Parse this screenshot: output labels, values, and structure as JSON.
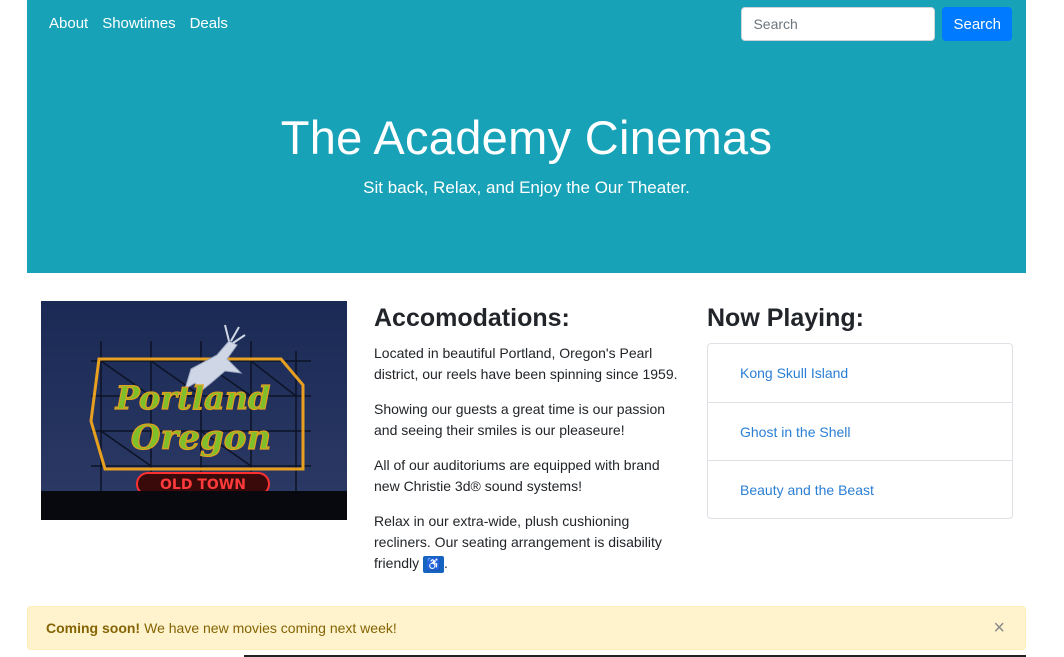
{
  "nav": {
    "links": [
      "About",
      "Showtimes",
      "Deals"
    ]
  },
  "search": {
    "placeholder": "Search",
    "button_label": "Search"
  },
  "hero": {
    "title": "The Academy Cinemas",
    "subtitle": "Sit back, Relax, and Enjoy the Our Theater."
  },
  "image": {
    "sign_text_1": "Portland",
    "sign_text_2": "Oregon",
    "sign_text_3": "OLD TOWN"
  },
  "accommodations": {
    "heading": "Accomodations:",
    "paragraphs": [
      "Located in beautiful Portland, Oregon's Pearl district, our reels have been spinning since 1959.",
      "Showing our guests a great time is our passion and seeing their smiles is our pleaseure!",
      "All of our auditoriums are equipped with brand new Christie 3d® sound systems!",
      "Relax in our extra-wide, plush cushioning recliners. Our seating arrangement is disability friendly"
    ],
    "accessibility_icon": "♿",
    "trailing_period": "."
  },
  "now_playing": {
    "heading": "Now Playing:",
    "movies": [
      "Kong Skull Island",
      "Ghost in the Shell",
      "Beauty and the Beast"
    ]
  },
  "alert": {
    "strong": "Coming soon!",
    "text": "We have new movies coming next week!",
    "close_glyph": "×"
  },
  "colors": {
    "hero_bg": "#17a2b8",
    "primary": "#007bff",
    "alert_bg": "#fff3cd",
    "link": "#2a7fd4"
  }
}
